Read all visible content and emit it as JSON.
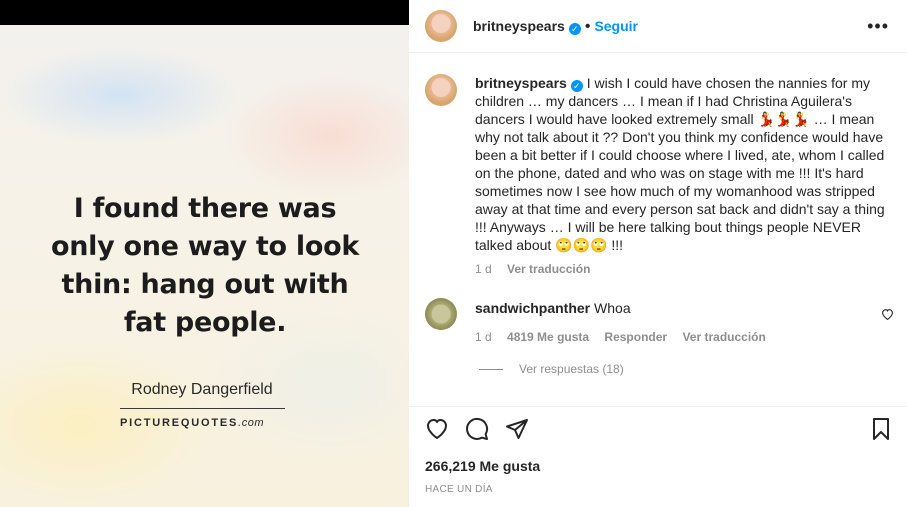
{
  "post_image": {
    "quote": "I found there was only one way to look thin: hang out with fat people.",
    "author": "Rodney Dangerfield",
    "watermark_main": "PICTUREQUOTES",
    "watermark_dom": ".com"
  },
  "header": {
    "username": "britneyspears",
    "verified_icon": "verified-badge-icon",
    "dot": "•",
    "follow_label": "Seguir",
    "more_icon": "•••"
  },
  "caption": {
    "username": "britneyspears",
    "text_part1": "I wish I could have chosen the nannies for my children … my dancers … I mean if I had Christina Aguilera's dancers I would have looked extremely small",
    "emoji_1": "💃💃💃",
    "text_part2": "… I mean why not talk about it ?? Don't you think my confidence would have been a bit better if I could choose where I lived, ate, whom I called on the phone, dated and who was on stage with me !!! It's hard sometimes now I see how much of my womanhood was stripped away at that time and every person sat back and didn't say a thing !!! Anyways … I will be here talking bout things people NEVER talked about",
    "emoji_2": "🙄🙄🙄",
    "text_part3": "!!!",
    "age": "1 d",
    "translate": "Ver traducción"
  },
  "comment": {
    "username": "sandwichpanther",
    "text": "Whoa",
    "age": "1 d",
    "likes": "4819 Me gusta",
    "reply": "Responder",
    "translate": "Ver traducción",
    "view_replies": "Ver respuestas (18)"
  },
  "footer": {
    "likes": "266,219 Me gusta",
    "time": "HACE UN DÍA"
  }
}
